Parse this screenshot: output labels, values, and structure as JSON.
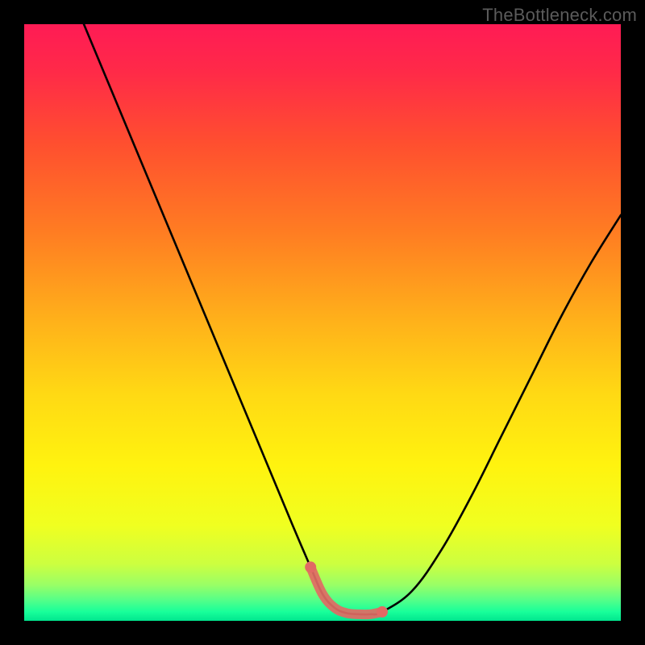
{
  "watermark": "TheBottleneck.com",
  "colors": {
    "background_black": "#000000",
    "curve_black": "#000000",
    "highlight_red": "#e16a64",
    "gradient_stops": [
      {
        "pos": 0.0,
        "color": "#ff1b55"
      },
      {
        "pos": 0.08,
        "color": "#ff2a48"
      },
      {
        "pos": 0.2,
        "color": "#ff4f2f"
      },
      {
        "pos": 0.35,
        "color": "#ff7d22"
      },
      {
        "pos": 0.5,
        "color": "#ffb21a"
      },
      {
        "pos": 0.62,
        "color": "#ffd914"
      },
      {
        "pos": 0.74,
        "color": "#fff30f"
      },
      {
        "pos": 0.84,
        "color": "#f0ff20"
      },
      {
        "pos": 0.905,
        "color": "#ccff40"
      },
      {
        "pos": 0.94,
        "color": "#99ff66"
      },
      {
        "pos": 0.965,
        "color": "#55ff88"
      },
      {
        "pos": 0.985,
        "color": "#18ff9a"
      },
      {
        "pos": 1.0,
        "color": "#00e58e"
      }
    ]
  },
  "chart_data": {
    "type": "line",
    "title": "",
    "xlabel": "",
    "ylabel": "",
    "xlim": [
      0,
      100
    ],
    "ylim": [
      0,
      100
    ],
    "curve": {
      "x": [
        10,
        15,
        20,
        25,
        30,
        35,
        40,
        45,
        48,
        50,
        52,
        54,
        56,
        58,
        60,
        65,
        70,
        75,
        80,
        85,
        90,
        95,
        100
      ],
      "y": [
        100,
        88,
        76,
        64,
        52,
        40,
        28,
        16,
        9,
        4.5,
        2.2,
        1.3,
        1.1,
        1.1,
        1.5,
        5,
        12,
        21,
        31,
        41,
        51,
        60,
        68
      ]
    },
    "highlight_segment": {
      "x": [
        48,
        50,
        52,
        54,
        56,
        58,
        60
      ],
      "y": [
        9,
        4.5,
        2.2,
        1.3,
        1.1,
        1.1,
        1.5
      ]
    }
  }
}
